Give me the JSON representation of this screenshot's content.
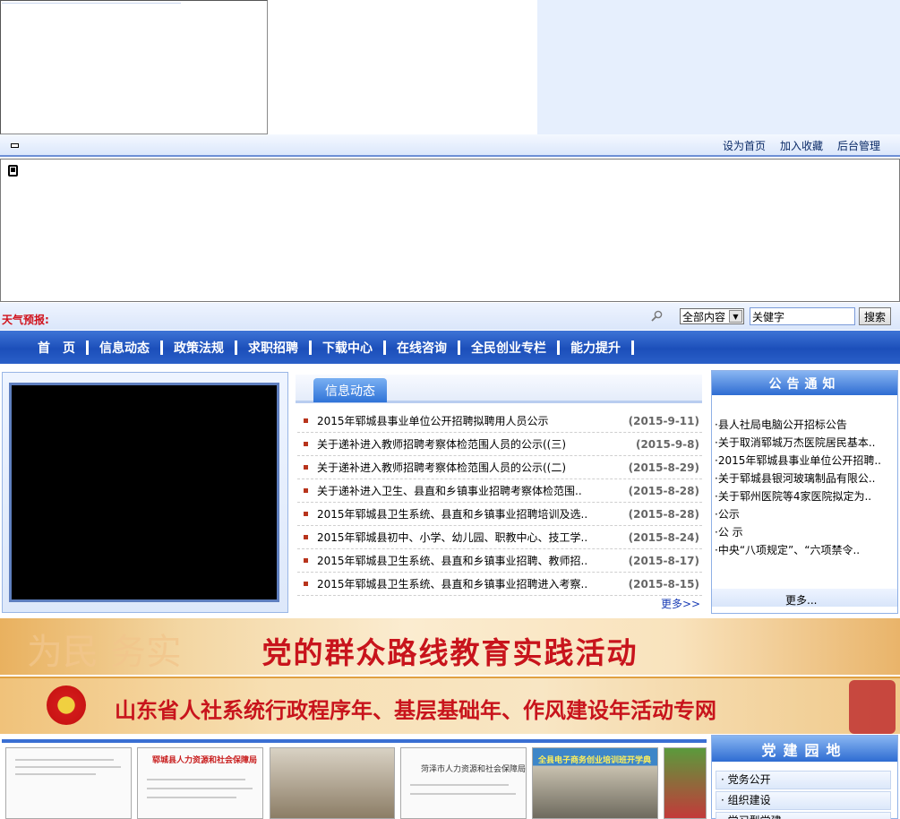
{
  "util": {
    "links": [
      "设为首页",
      "加入收藏",
      "后台管理"
    ]
  },
  "weather": {
    "label": "天气预报:"
  },
  "search": {
    "select_value": "全部内容",
    "input_value": "关健字",
    "button_label": "搜索"
  },
  "nav": {
    "items": [
      "首　页",
      "信息动态",
      "政策法规",
      "求职招聘",
      "下载中心",
      "在线咨询",
      "全民创业专栏",
      "能力提升"
    ]
  },
  "news": {
    "tab_label": "信息动态",
    "more_label": "更多>>",
    "items": [
      {
        "title": "2015年郓城县事业单位公开招聘拟聘用人员公示",
        "date": "(2015-9-11)"
      },
      {
        "title": "关于递补进入教师招聘考察体检范围人员的公示((三)",
        "date": "(2015-9-8)"
      },
      {
        "title": "关于递补进入教师招聘考察体检范围人员的公示((二)",
        "date": "(2015-8-29)"
      },
      {
        "title": "关于递补进入卫生、县直和乡镇事业招聘考察体检范围..",
        "date": "(2015-8-28)"
      },
      {
        "title": "2015年郓城县卫生系统、县直和乡镇事业招聘培训及选..",
        "date": "(2015-8-28)"
      },
      {
        "title": "2015年郓城县初中、小学、幼儿园、职教中心、技工学..",
        "date": "(2015-8-24)"
      },
      {
        "title": "2015年郓城县卫生系统、县直和乡镇事业招聘、教师招..",
        "date": "(2015-8-17)"
      },
      {
        "title": "2015年郓城县卫生系统、县直和乡镇事业招聘进入考察..",
        "date": "(2015-8-15)"
      }
    ]
  },
  "notice": {
    "title": "公告通知",
    "more_label": "更多...",
    "items": [
      "·县人社局电脑公开招标公告",
      "·关于取消郓城万杰医院居民基本..",
      "·2015年郓城县事业单位公开招聘..",
      "·关于郓城县银河玻璃制品有限公..",
      "·关于郓州医院等4家医院拟定为..",
      "·公示",
      "·公 示",
      "·中央“八项规定”、“六项禁令.."
    ]
  },
  "banner1": {
    "text": "党的群众路线教育实践活动",
    "deco": "为民 务实"
  },
  "banner2": {
    "text": "山东省人社系统行政程序年、基层基础年、作风建设年活动专网"
  },
  "photos": {
    "titles": [
      "",
      "郓城县人力资源和社会保障局",
      "",
      "菏泽市人力资源和社会保障局文件",
      "全县电子商务创业培训班开学典",
      ""
    ]
  },
  "party": {
    "title": "党建园地",
    "items": [
      "· 党务公开",
      "· 组织建设",
      "· 学习型党建"
    ]
  },
  "colors": {
    "nav_blue": "#1c4fba",
    "banner_red": "#c8141c",
    "weather_red": "#d0101a"
  }
}
